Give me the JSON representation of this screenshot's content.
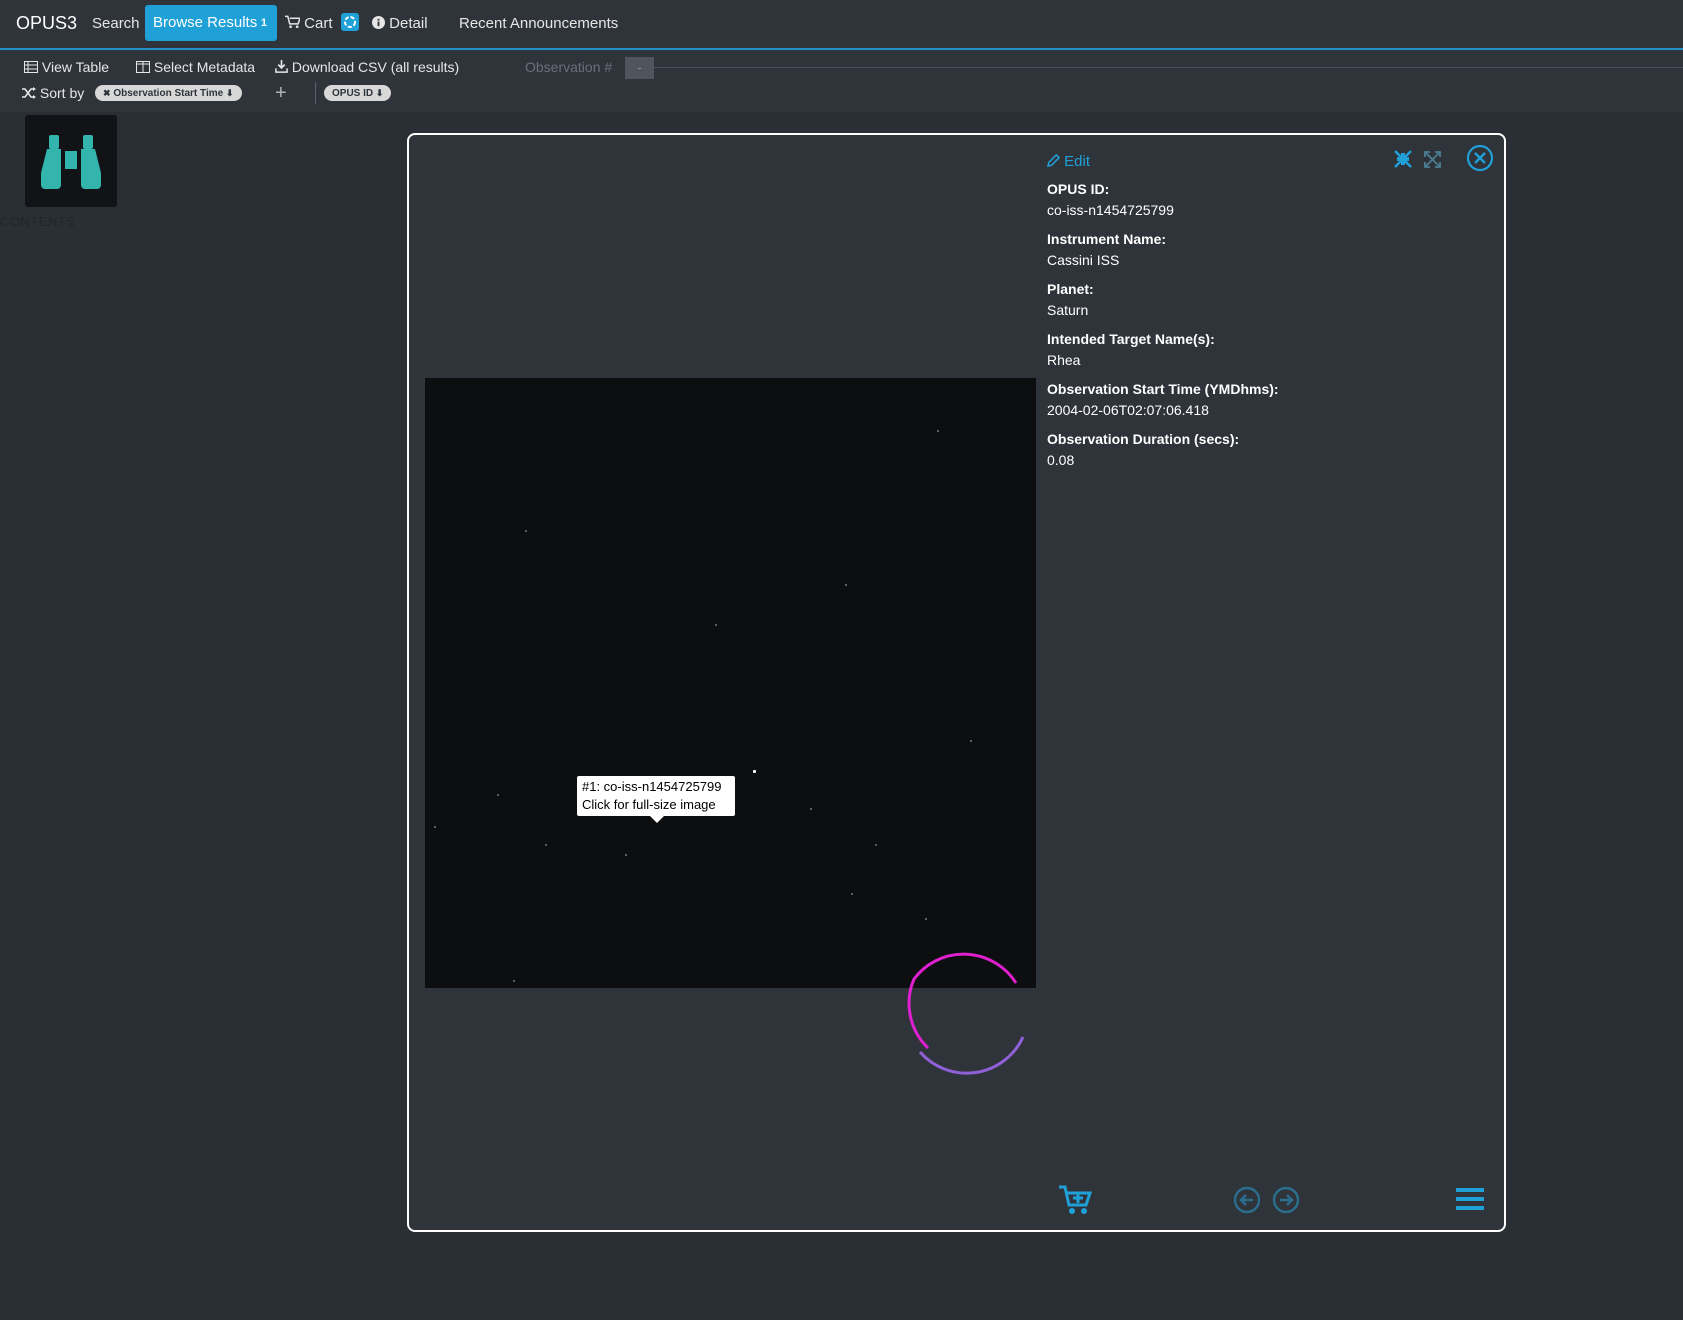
{
  "app": {
    "title": "OPUS3"
  },
  "nav": {
    "search": "Search",
    "browse_results": "Browse Results",
    "browse_results_count": "1",
    "cart": "Cart",
    "detail": "Detail",
    "recent_announcements": "Recent Announcements"
  },
  "toolbar": {
    "view_table": "View Table",
    "select_metadata": "Select Metadata",
    "download_csv": "Download CSV (all results)",
    "observation_label": "Observation #",
    "observation_value": "-",
    "sort_by": "Sort by",
    "sort_pills": [
      "Observation Start Time",
      "OPUS ID"
    ]
  },
  "sidebar": {
    "contents_label": "CONTENTS"
  },
  "modal": {
    "edit": "Edit",
    "tooltip": {
      "line1": "#1: co-iss-n1454725799",
      "line2": "Click for full-size image"
    },
    "metadata": [
      {
        "label": "OPUS ID:",
        "value": "co-iss-n1454725799"
      },
      {
        "label": "Instrument Name:",
        "value": "Cassini ISS"
      },
      {
        "label": "Planet:",
        "value": "Saturn"
      },
      {
        "label": "Intended Target Name(s):",
        "value": "Rhea"
      },
      {
        "label": "Observation Start Time (YMDhms):",
        "value": "2004-02-06T02:07:06.418"
      },
      {
        "label": "Observation Duration (secs):",
        "value": "0.08"
      }
    ]
  },
  "icons": {
    "binoculars": "binoculars-icon",
    "cart": "cart-icon",
    "info": "info-icon",
    "edit": "pencil-icon",
    "compress": "compress-icon",
    "expand": "expand-icon",
    "close": "close-circle-icon",
    "add_to_cart": "cart-plus-icon",
    "prev": "arrow-left-circle-icon",
    "next": "arrow-right-circle-icon",
    "menu": "hamburger-menu-icon",
    "spinner": "loading-spinner-icon"
  },
  "colors": {
    "accent": "#1fa1d8",
    "background": "#2a2e35",
    "panel": "#2f343b",
    "logo_teal": "#33b5ad",
    "spinner_magenta": "#e020d0",
    "spinner_purple": "#9060d8"
  }
}
